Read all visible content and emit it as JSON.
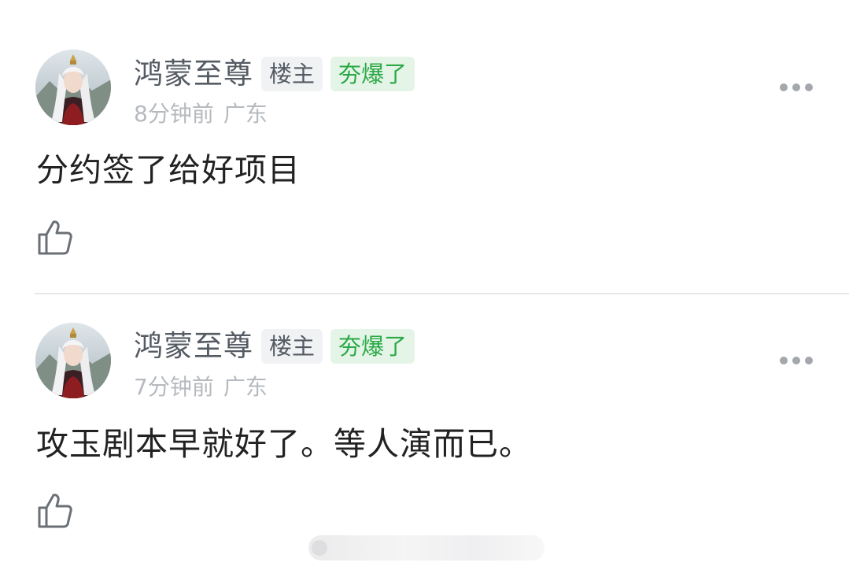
{
  "comments": [
    {
      "username": "鸿蒙至尊",
      "badge_owner": "楼主",
      "badge_hot": "夯爆了",
      "time": "8分钟前",
      "location": "广东",
      "content": "分约签了给好项目"
    },
    {
      "username": "鸿蒙至尊",
      "badge_owner": "楼主",
      "badge_hot": "夯爆了",
      "time": "7分钟前",
      "location": "广东",
      "content": "攻玉剧本早就好了。等人演而已。"
    }
  ],
  "icons": {
    "more": "more-dots-icon",
    "like": "thumbs-up-icon",
    "avatar": "avatar-portrait"
  },
  "colors": {
    "hot_badge_text": "#2aa845",
    "hot_badge_bg": "#e4f5e7",
    "owner_badge_bg": "#f1f2f4",
    "username": "#555b63",
    "meta": "#b6babf",
    "content": "#222222"
  }
}
